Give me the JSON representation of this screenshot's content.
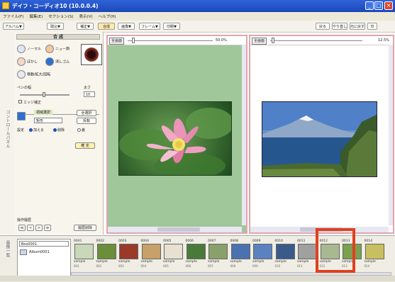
{
  "window": {
    "title": "デイフ・コーディオ10 (10.0.0.4)",
    "min_label": "_",
    "max_label": "□",
    "close_label": "×"
  },
  "menu": [
    "ファイル(F)",
    "編集(E)",
    "セクション(S)",
    "表示(V)",
    "ヘルプ(H)"
  ],
  "toolbar": {
    "left": [
      "アルバム▼",
      "取込▼",
      "補正▼",
      "合成",
      "画像▼",
      "フレーム▼",
      "印刷▼"
    ],
    "highlighted": "合成",
    "right": [
      "戻る",
      "やり直し",
      "元に戻す",
      "印"
    ]
  },
  "side_labels": {
    "left": "コントロールパネル",
    "bottom": "画像一覧"
  },
  "control_panel": {
    "header": "合 成",
    "modes": [
      {
        "label": "ノーマル",
        "color": "#dfe6f7"
      },
      {
        "label": "ぼかし",
        "color": "#f5d6c8"
      },
      {
        "label": "ニュー顔",
        "color": "#f2c7a0"
      },
      {
        "label": "消しゴム",
        "color": "#2c6fd6"
      },
      {
        "label": "移動/拡大/回転",
        "color": "#e8e8f0"
      }
    ],
    "pen_label": "ペンの幅",
    "pen_value_label": "太さ",
    "pen_value": "10",
    "edge_label": "エッジ補正",
    "region_header": "領域選択",
    "region_btn": "全選択",
    "region_dropdown": "矩形",
    "region_invert": "反転",
    "region_mode_label": "設定",
    "region_opts": [
      "加える",
      "削除",
      "差"
    ],
    "apply_btn": "確 定",
    "history_header": "操作履歴",
    "history_nav": [
      "≪",
      "<",
      ">",
      "≫"
    ],
    "history_btn": "履歴削除"
  },
  "view_left": {
    "fit_label": "全画面",
    "zoom": "50.0%"
  },
  "view_right": {
    "fit_label": "全画面",
    "zoom": "12.5%"
  },
  "album": {
    "name": "Box0001",
    "sub": "Album0001"
  },
  "thumbs": [
    {
      "num": "0001",
      "cap": "sample",
      "cap2": "001",
      "color": "#c8d8b8"
    },
    {
      "num": "0002",
      "cap": "sample",
      "cap2": "002",
      "color": "#6a8e3a"
    },
    {
      "num": "0003",
      "cap": "sample",
      "cap2": "003",
      "color": "#9a3a2a"
    },
    {
      "num": "0004",
      "cap": "sample",
      "cap2": "004",
      "color": "#c8a06a"
    },
    {
      "num": "0005",
      "cap": "sample",
      "cap2": "005",
      "color": "#e8e0d0"
    },
    {
      "num": "0006",
      "cap": "sample",
      "cap2": "006",
      "color": "#4a7a3a"
    },
    {
      "num": "0007",
      "cap": "sample",
      "cap2": "007",
      "color": "#8aa06a"
    },
    {
      "num": "0008",
      "cap": "sample",
      "cap2": "008",
      "color": "#4a72b0"
    },
    {
      "num": "0009",
      "cap": "sample",
      "cap2": "009",
      "color": "#5a82c0"
    },
    {
      "num": "0010",
      "cap": "sample",
      "cap2": "010",
      "color": "#3a5a8a"
    },
    {
      "num": "0011",
      "cap": "sample",
      "cap2": "011",
      "color": "#a0a0a0"
    },
    {
      "num": "0012",
      "cap": "sample",
      "cap2": "012",
      "color": "#a8b890"
    },
    {
      "num": "0013",
      "cap": "sample",
      "cap2": "013",
      "color": "#7aa050"
    },
    {
      "num": "0014",
      "cap": "sample",
      "cap2": "014",
      "color": "#c8c060"
    }
  ]
}
